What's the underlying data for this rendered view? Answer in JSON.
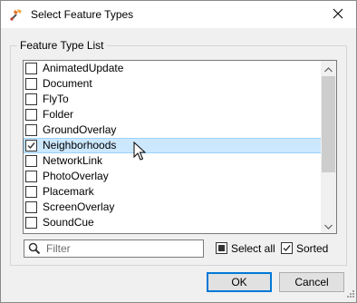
{
  "dialog": {
    "title": "Select Feature Types",
    "close_icon": "close-icon",
    "app_icon": "fme-workbench-icon"
  },
  "group": {
    "label": "Feature Type List"
  },
  "list": {
    "items": [
      {
        "label": "AnimatedUpdate",
        "checked": false,
        "selected": false
      },
      {
        "label": "Document",
        "checked": false,
        "selected": false
      },
      {
        "label": "FlyTo",
        "checked": false,
        "selected": false
      },
      {
        "label": "Folder",
        "checked": false,
        "selected": false
      },
      {
        "label": "GroundOverlay",
        "checked": false,
        "selected": false
      },
      {
        "label": "Neighborhoods",
        "checked": true,
        "selected": true
      },
      {
        "label": "NetworkLink",
        "checked": false,
        "selected": false
      },
      {
        "label": "PhotoOverlay",
        "checked": false,
        "selected": false
      },
      {
        "label": "Placemark",
        "checked": false,
        "selected": false
      },
      {
        "label": "ScreenOverlay",
        "checked": false,
        "selected": false
      },
      {
        "label": "SoundCue",
        "checked": false,
        "selected": false
      }
    ]
  },
  "filter": {
    "placeholder": "Filter",
    "value": "",
    "icon": "search-icon"
  },
  "options": {
    "select_all_label": "Select all",
    "select_all_state": "indeterminate",
    "sorted_label": "Sorted",
    "sorted_checked": true
  },
  "buttons": {
    "ok_label": "OK",
    "cancel_label": "Cancel"
  },
  "colors": {
    "selection_bg": "#cce8ff",
    "selection_border": "#99d1ff",
    "default_button_border": "#0078d7"
  }
}
